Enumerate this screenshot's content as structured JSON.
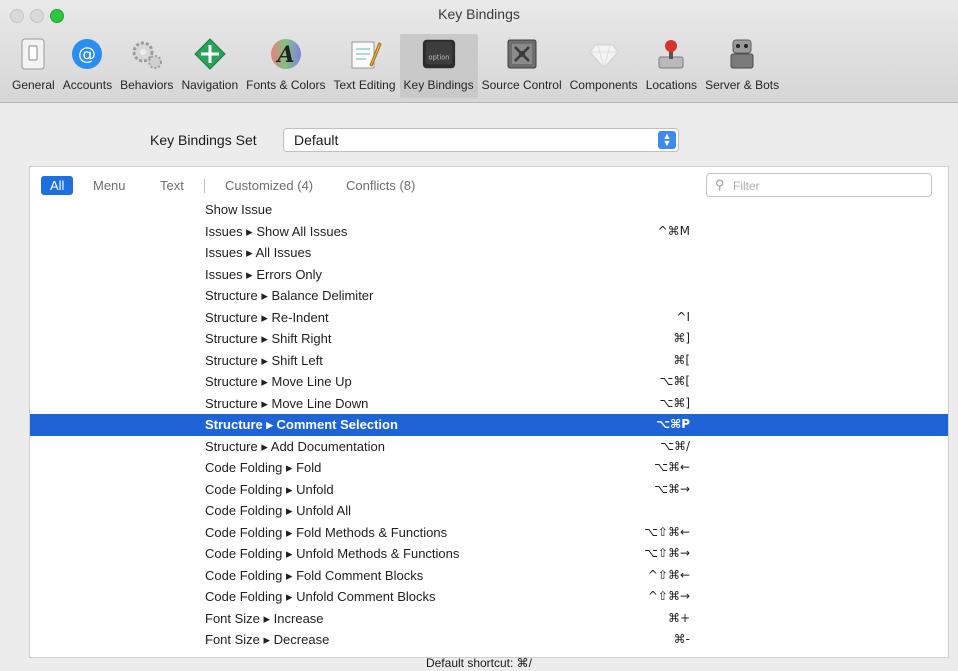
{
  "window": {
    "title": "Key Bindings",
    "controls": [
      "close",
      "minimize",
      "zoom"
    ]
  },
  "toolbar": {
    "items": [
      {
        "label": "General",
        "icon": "switch-icon"
      },
      {
        "label": "Accounts",
        "icon": "at-sign-icon"
      },
      {
        "label": "Behaviors",
        "icon": "gears-icon"
      },
      {
        "label": "Navigation",
        "icon": "arrows-diamond-icon"
      },
      {
        "label": "Fonts & Colors",
        "icon": "font-color-icon"
      },
      {
        "label": "Text Editing",
        "icon": "notepad-pencil-icon"
      },
      {
        "label": "Key Bindings",
        "icon": "option-key-icon",
        "active": true
      },
      {
        "label": "Source Control",
        "icon": "vault-icon"
      },
      {
        "label": "Components",
        "icon": "gem-icon"
      },
      {
        "label": "Locations",
        "icon": "joystick-icon"
      },
      {
        "label": "Server & Bots",
        "icon": "robot-icon"
      }
    ]
  },
  "key_bindings_set": {
    "label": "Key Bindings Set",
    "value": "Default"
  },
  "filters": {
    "all": "All",
    "menu": "Menu",
    "text": "Text",
    "customized": "Customized (4)",
    "conflicts": "Conflicts (8)",
    "search_placeholder": "Filter"
  },
  "bindings": [
    {
      "command": "Show Issue",
      "key": ""
    },
    {
      "command": "Issues ▸ Show All Issues",
      "key": "^⌘M"
    },
    {
      "command": "Issues ▸ All Issues",
      "key": ""
    },
    {
      "command": "Issues ▸ Errors Only",
      "key": ""
    },
    {
      "command": "Structure ▸ Balance Delimiter",
      "key": ""
    },
    {
      "command": "Structure ▸ Re-Indent",
      "key": "^I"
    },
    {
      "command": "Structure ▸ Shift Right",
      "key": "⌘]"
    },
    {
      "command": "Structure ▸ Shift Left",
      "key": "⌘["
    },
    {
      "command": "Structure ▸ Move Line Up",
      "key": "⌥⌘["
    },
    {
      "command": "Structure ▸ Move Line Down",
      "key": "⌥⌘]"
    },
    {
      "command": "Structure ▸ Comment Selection",
      "key": "⌥⌘P",
      "selected": true
    },
    {
      "command": "Structure ▸ Add Documentation",
      "key": "⌥⌘/"
    },
    {
      "command": "Code Folding ▸ Fold",
      "key": "⌥⌘←"
    },
    {
      "command": "Code Folding ▸ Unfold",
      "key": "⌥⌘→"
    },
    {
      "command": "Code Folding ▸ Unfold All",
      "key": ""
    },
    {
      "command": "Code Folding ▸ Fold Methods & Functions",
      "key": "⌥⇧⌘←"
    },
    {
      "command": "Code Folding ▸ Unfold Methods & Functions",
      "key": "⌥⇧⌘→"
    },
    {
      "command": "Code Folding ▸ Fold Comment Blocks",
      "key": "^⇧⌘←"
    },
    {
      "command": "Code Folding ▸ Unfold Comment Blocks",
      "key": "^⇧⌘→"
    },
    {
      "command": "Font Size ▸ Increase",
      "key": "⌘+"
    },
    {
      "command": "Font Size ▸ Decrease",
      "key": "⌘-"
    }
  ],
  "status": {
    "default_shortcut": "Default shortcut: ⌘/"
  },
  "colors": {
    "selection": "#1f64d6",
    "all_filter": "#1f6fe0",
    "zoom_button": "#2dc63f"
  }
}
